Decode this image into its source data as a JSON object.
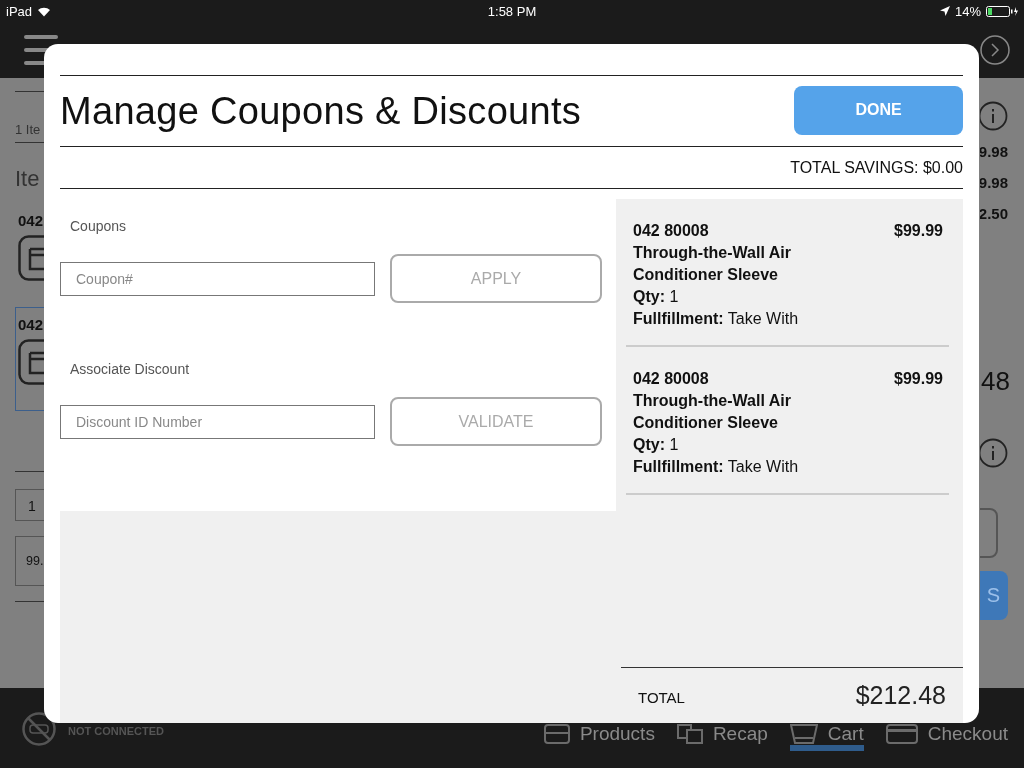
{
  "status_bar": {
    "carrier": "iPad",
    "time": "1:58 PM",
    "battery": "14%"
  },
  "background": {
    "item_count": "1 Ite",
    "section_title": "Ite",
    "items": [
      {
        "code": "042",
        "selected": false
      },
      {
        "code": "042",
        "selected": true
      }
    ],
    "quantity": "1",
    "price": "99.",
    "amounts": [
      "9.98",
      "9.98",
      "2.50"
    ],
    "grand_total": "48",
    "button_text": "S"
  },
  "connection": {
    "label": "NOT CONNECTED"
  },
  "nav_tabs": [
    {
      "label": "Products",
      "selected": false
    },
    {
      "label": "Recap",
      "selected": false
    },
    {
      "label": "Cart",
      "selected": true
    },
    {
      "label": "Checkout",
      "selected": false
    }
  ],
  "dialog": {
    "title": "Manage Coupons & Discounts",
    "done_button": "DONE",
    "total_savings": "TOTAL SAVINGS: $0.00",
    "coupons": {
      "label": "Coupons",
      "placeholder": "Coupon#",
      "button": "APPLY"
    },
    "associate_discount": {
      "label": "Associate Discount",
      "placeholder": "Discount ID Number",
      "button": "VALIDATE"
    },
    "cart_items": [
      {
        "code": "042 80008",
        "name": "Through-the-Wall Air Conditioner Sleeve",
        "qty": "**Qty:** 1",
        "fulfillment": "**Fullfillment:** Take With",
        "price": "$99.99"
      },
      {
        "code": "042 80008",
        "name": "Through-the-Wall Air Conditioner Sleeve",
        "qty": "**Qty:** 1",
        "fulfillment": "**Fullfillment:** Take With",
        "price": "$99.99"
      }
    ],
    "total_label": "TOTAL",
    "total": "$212.48"
  }
}
